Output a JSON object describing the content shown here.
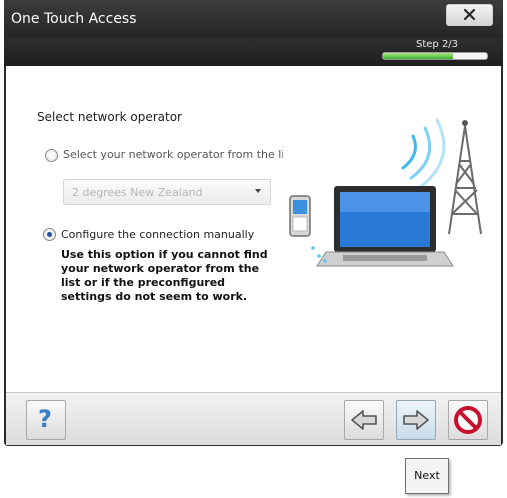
{
  "window": {
    "title": "One Touch Access"
  },
  "step": {
    "label": "Step 2/3",
    "progress": 0.67
  },
  "page": {
    "heading": "Select network operator",
    "option_list": {
      "label": "Select your network operator from the list.",
      "selected": false
    },
    "operator_select": {
      "value": "2 degrees New Zealand"
    },
    "option_manual": {
      "label": "Configure the connection manually",
      "selected": true
    },
    "manual_description": "Use this option if you cannot find your network operator from the list or if the preconfigured settings do not seem to work."
  },
  "toolbar": {
    "help_icon": "question-mark-icon",
    "back_icon": "arrow-left-icon",
    "next_icon": "arrow-right-icon",
    "cancel_icon": "no-entry-icon"
  },
  "tooltip": {
    "text": "Next"
  },
  "colors": {
    "titlebar": "#2b2b2b",
    "progress": "#3fae2c",
    "accent": "#3a7fc4",
    "cancel": "#c8102e"
  }
}
